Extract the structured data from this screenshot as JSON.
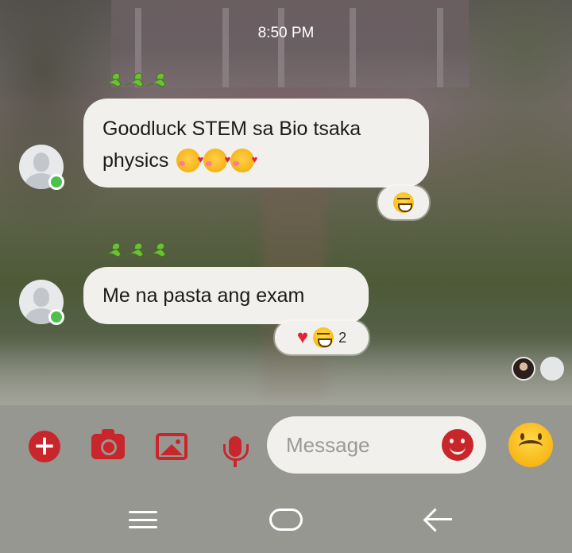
{
  "chat": {
    "timestamp": "8:50 PM",
    "messages": [
      {
        "sender_tag": "🐍🐍🐍",
        "text_line1": "Goodluck STEM sa Bio tsaka",
        "text_line2": "physics",
        "inline_emoji": "smiling-face-with-hearts x3",
        "reactions": {
          "icons": [
            "grinning-squinting-face"
          ],
          "count": ""
        }
      },
      {
        "sender_tag": "🐍🐍🐍",
        "text_line1": "Me na pasta ang exam",
        "reactions": {
          "icons": [
            "red-heart",
            "grinning-squinting-face"
          ],
          "count": "2"
        }
      }
    ],
    "sender_online": true
  },
  "composer": {
    "placeholder": "Message",
    "buttons": [
      "add",
      "camera",
      "gallery",
      "microphone",
      "sticker",
      "emoji"
    ]
  },
  "colors": {
    "accent": "#c8262b",
    "bubble": "#f2f0ec",
    "online": "#4cc24a",
    "composer_bg": "#979791"
  }
}
